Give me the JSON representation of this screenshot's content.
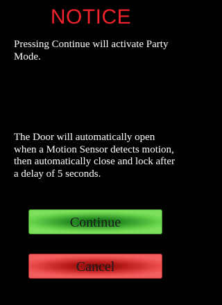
{
  "notice": {
    "title": "NOTICE",
    "message_activate": "Pressing Continue will activate Party Mode.",
    "message_details": "The Door will automatically open when a Motion Sensor detects motion, then automatically close and lock after a delay of 5 seconds."
  },
  "buttons": {
    "continue_label": "Continue",
    "cancel_label": "Cancel"
  },
  "colors": {
    "title": "#f2222c",
    "text": "#ffffff",
    "background": "#000000",
    "continue": "#4fc13b",
    "cancel": "#e03a3a"
  }
}
